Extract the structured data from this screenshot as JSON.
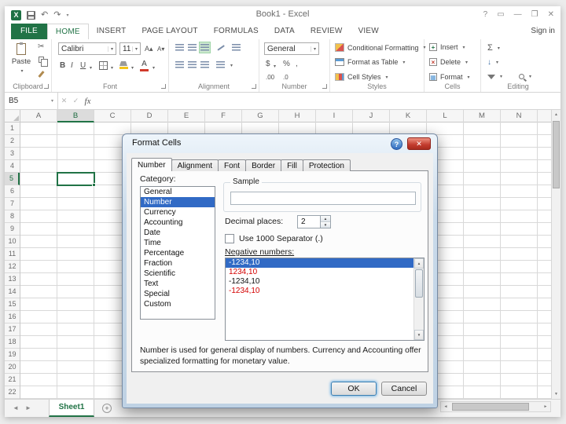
{
  "window": {
    "title": "Book1 - Excel"
  },
  "icons": {
    "dropdown": "▾",
    "up_arrow": "▲",
    "down_arrow": "▼",
    "left_arrow": "◄",
    "right_arrow": "►",
    "undo": "↶",
    "redo": "↷",
    "scissors": "✂",
    "sigma": "Σ",
    "check": "✓",
    "cancel_x": "✕",
    "help": "?",
    "ribbon_options": "▭",
    "minimize": "—",
    "restore": "❐",
    "close": "✕",
    "bold": "B",
    "italic": "I",
    "underline": "U",
    "grow_font": "A▴",
    "shrink_font": "A▾",
    "dollar": "$",
    "percent": "%",
    "comma": ",",
    "inc_decimal": ".00",
    "dec_decimal": ".0",
    "fill_down": "↓",
    "plus": "+",
    "logo_x": "X"
  },
  "ribbon_tabs": [
    {
      "label": "FILE",
      "file": true
    },
    {
      "label": "HOME",
      "active": true
    },
    {
      "label": "INSERT"
    },
    {
      "label": "PAGE LAYOUT"
    },
    {
      "label": "FORMULAS"
    },
    {
      "label": "DATA"
    },
    {
      "label": "REVIEW"
    },
    {
      "label": "VIEW"
    }
  ],
  "sign_in": "Sign in",
  "ribbon": {
    "group_labels": [
      "Clipboard",
      "Font",
      "Alignment",
      "Number",
      "Styles",
      "Cells",
      "Editing"
    ],
    "paste": "Paste",
    "font_name": "Calibri",
    "font_size": "11",
    "number_format": "General",
    "styles": [
      "Conditional Formatting",
      "Format as Table",
      "Cell Styles"
    ],
    "cells": [
      "Insert",
      "Delete",
      "Format"
    ]
  },
  "formula_bar": {
    "name_box": "B5",
    "fx": "fx",
    "value": ""
  },
  "grid": {
    "columns": [
      "A",
      "B",
      "C",
      "D",
      "E",
      "F",
      "G",
      "H",
      "I",
      "J",
      "K",
      "L",
      "M",
      "N"
    ],
    "rows": [
      1,
      2,
      3,
      4,
      5,
      6,
      7,
      8,
      9,
      10,
      11,
      12,
      13,
      14,
      15,
      16,
      17,
      18,
      19,
      20,
      21,
      22
    ],
    "active_cell": {
      "ref": "B5",
      "col": "B",
      "row": 5
    }
  },
  "sheet_bar": {
    "sheet": "Sheet1"
  },
  "dialog": {
    "title": "Format Cells",
    "tabs": [
      {
        "label": "Number",
        "active": true
      },
      {
        "label": "Alignment"
      },
      {
        "label": "Font"
      },
      {
        "label": "Border"
      },
      {
        "label": "Fill"
      },
      {
        "label": "Protection"
      }
    ],
    "category_label": "Category:",
    "categories": [
      "General",
      "Number",
      "Currency",
      "Accounting",
      "Date",
      "Time",
      "Percentage",
      "Fraction",
      "Scientific",
      "Text",
      "Special",
      "Custom"
    ],
    "selected_category": "Number",
    "sample_label": "Sample",
    "sample_value": "",
    "decimal_label": "Decimal places:",
    "decimal_value": "2",
    "separator_label": "Use 1000 Separator (.)",
    "separator_checked": false,
    "negative_label": "Negative numbers:",
    "negative_options": [
      {
        "text": "-1234,10",
        "variant": "selected"
      },
      {
        "text": "1234,10",
        "variant": "red"
      },
      {
        "text": "-1234,10",
        "variant": "black"
      },
      {
        "text": "-1234,10",
        "variant": "red"
      }
    ],
    "description": "Number is used for general display of numbers.  Currency and Accounting offer specialized formatting for monetary value.",
    "ok_label": "OK",
    "cancel_label": "Cancel"
  }
}
